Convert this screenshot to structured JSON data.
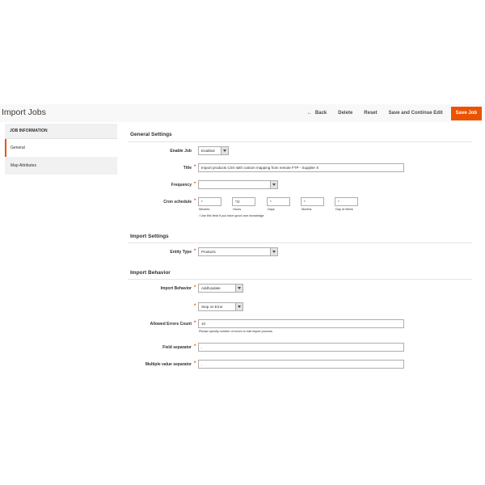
{
  "header": {
    "title": "Import Jobs",
    "back": "Back",
    "back_icon": "←",
    "delete": "Delete",
    "reset": "Reset",
    "save_continue": "Save and Continue Edit",
    "save_job": "Save Job"
  },
  "sidebar": {
    "heading": "JOB INFORMATION",
    "items": [
      {
        "label": "General"
      },
      {
        "label": "Map Attributes"
      }
    ]
  },
  "general_settings": {
    "title": "General Settings",
    "enable_job": {
      "label": "Enable Job",
      "value": "Enabled"
    },
    "title_field": {
      "label": "Title",
      "value": "Import products CSV with custom mapping from remote FTP - Supplier X"
    },
    "frequency": {
      "label": "Frequency",
      "value": ""
    },
    "cron": {
      "label": "Cron schedule",
      "fields": [
        {
          "value": "*",
          "caption": "Minutes"
        },
        {
          "value": "*/2",
          "caption": "Hours"
        },
        {
          "value": "*",
          "caption": "Days"
        },
        {
          "value": "*",
          "caption": "Months"
        },
        {
          "value": "*",
          "caption": "Day of Week"
        }
      ],
      "note": "! Use this field if you have good cron knowledge."
    }
  },
  "import_settings": {
    "title": "Import Settings",
    "entity_type": {
      "label": "Entity Type",
      "value": "Products"
    }
  },
  "import_behavior": {
    "title": "Import Behavior",
    "behavior": {
      "label": "Import Behavior",
      "value": "Add/Update"
    },
    "on_error": {
      "value": "Stop on Error"
    },
    "allowed_errors": {
      "label": "Allowed Errors Count",
      "value": "10",
      "note": "Please specify number of errors to halt import process"
    },
    "field_separator": {
      "label": "Field separator",
      "value": ","
    },
    "multi_separator": {
      "label": "Multiple value separator",
      "value": ","
    }
  },
  "colors": {
    "accent": "#eb5202",
    "text": "#303030"
  }
}
